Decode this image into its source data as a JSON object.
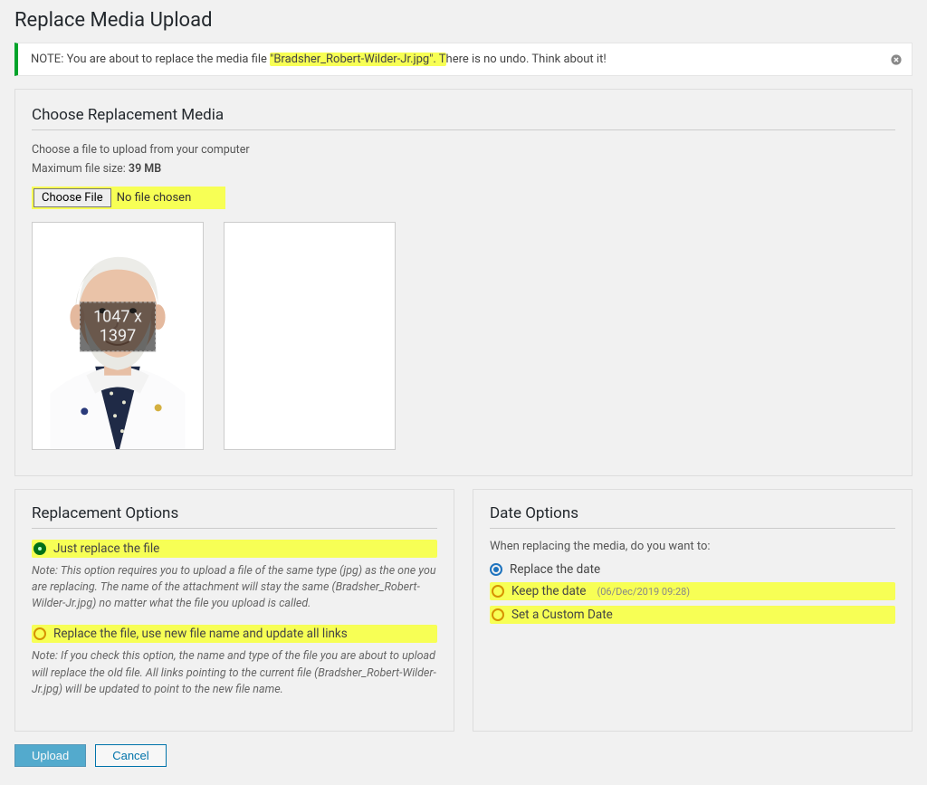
{
  "page": {
    "title": "Replace Media Upload"
  },
  "notice": {
    "prefix": "NOTE: You are about to replace the media file ",
    "filename_quoted": "\"Bradsher_Robert-Wilder-Jr.jpg\". T",
    "suffix": "here is no undo. Think about it!"
  },
  "replacement_media": {
    "heading": "Choose Replacement Media",
    "instruction": "Choose a file to upload from your computer",
    "max_label": "Maximum file size: ",
    "max_value": "39 MB",
    "choose_button": "Choose File",
    "choose_status": "No file chosen",
    "dimensions_line1": "1047 x",
    "dimensions_line2": "1397"
  },
  "replacement_options": {
    "heading": "Replacement Options",
    "opt1_label": "Just replace the file",
    "opt1_note": "Note: This option requires you to upload a file of the same type (jpg) as the one you are replacing. The name of the attachment will stay the same (Bradsher_Robert-Wilder-Jr.jpg) no matter what the file you upload is called.",
    "opt2_label": "Replace the file, use new file name and update all links",
    "opt2_note": "Note: If you check this option, the name and type of the file you are about to upload will replace the old file. All links pointing to the current file (Bradsher_Robert-Wilder-Jr.jpg) will be updated to point to the new file name."
  },
  "date_options": {
    "heading": "Date Options",
    "prompt": "When replacing the media, do you want to:",
    "opt1_label": "Replace the date",
    "opt2_label": "Keep the date",
    "opt2_hint": "(06/Dec/2019 09:28)",
    "opt3_label": "Set a Custom Date"
  },
  "actions": {
    "upload": "Upload",
    "cancel": "Cancel"
  }
}
